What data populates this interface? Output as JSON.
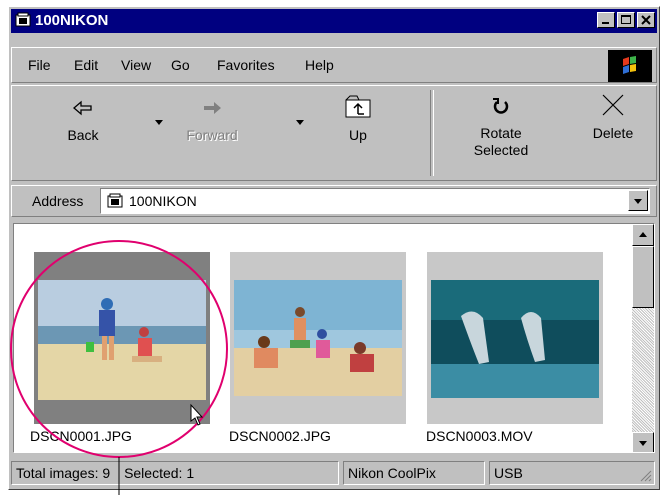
{
  "window": {
    "title": "100NIKON"
  },
  "menu": {
    "items": [
      "File",
      "Edit",
      "View",
      "Go",
      "Favorites",
      "Help"
    ]
  },
  "toolbar": {
    "back": "Back",
    "forward": "Forward",
    "up": "Up",
    "rotate": "Rotate Selected",
    "delete": "Delete"
  },
  "address": {
    "label": "Address",
    "value": "100NIKON"
  },
  "files": [
    "DSCN0001.JPG",
    "DSCN0002.JPG",
    "DSCN0003.MOV"
  ],
  "status": {
    "images": "Total images: 9",
    "selected": "Selected: 1",
    "camera": "Nikon CoolPix",
    "connection": "USB"
  },
  "colors": {
    "titlebar": "#000080",
    "callout": "#e0006e"
  }
}
